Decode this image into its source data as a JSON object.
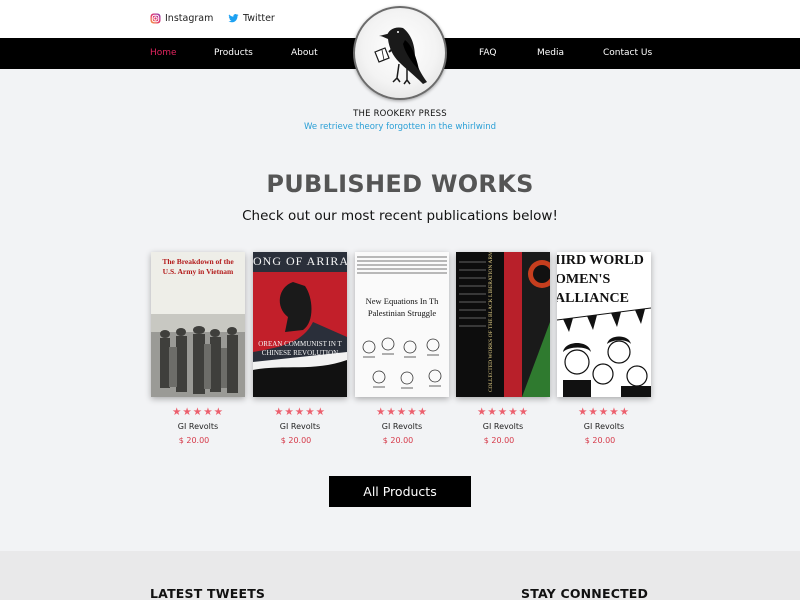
{
  "social": {
    "instagram_label": "Instagram",
    "twitter_label": "Twitter"
  },
  "nav": {
    "items": [
      "Home",
      "Products",
      "About",
      "FAQ",
      "Media",
      "Contact Us"
    ],
    "active": "Home"
  },
  "brand": {
    "name": "THE ROOKERY PRESS",
    "tagline": "We retrieve theory forgotten in the whirlwind"
  },
  "works": {
    "title": "PUBLISHED WORKS",
    "subtitle": "Check out our most recent publications below!",
    "rating": "★★★★★",
    "products": [
      {
        "name": "GI Revolts",
        "price": "$ 20.00",
        "cover_lines": [
          "The Breakdown of the",
          "U.S. Army in Vietnam"
        ]
      },
      {
        "name": "GI Revolts",
        "price": "$ 20.00",
        "cover_lines": [
          "ONG OF ARIRA",
          "OREAN COMMUNIST IN T",
          "CHINESE REVOLUTION"
        ]
      },
      {
        "name": "GI Revolts",
        "price": "$ 20.00",
        "cover_lines": [
          "New Equations In Th",
          "Palestinian Struggle"
        ]
      },
      {
        "name": "GI Revolts",
        "price": "$ 20.00",
        "cover_lines": [
          "COLLECTED WORKS OF THE BLACK LIBERATION ARMY"
        ]
      },
      {
        "name": "GI Revolts",
        "price": "$ 20.00",
        "cover_lines": [
          "IIRD WORLD",
          "OMEN'S",
          "ALLIANCE"
        ]
      }
    ],
    "button_label": "All Products"
  },
  "footer": {
    "latest_tweets": "LATEST TWEETS",
    "stay_connected": "STAY CONNECTED"
  },
  "colors": {
    "accent_active": "#e0245e",
    "tagline": "#2a9fd6",
    "stars": "#ec5f6d",
    "price": "#d63a4a",
    "navbar": "#000000"
  }
}
